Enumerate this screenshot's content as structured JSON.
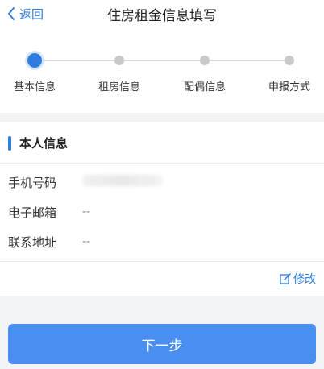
{
  "header": {
    "back_label": "返回",
    "title": "住房租金信息填写"
  },
  "stepper": {
    "steps": [
      {
        "label": "基本信息",
        "active": true
      },
      {
        "label": "租房信息",
        "active": false
      },
      {
        "label": "配偶信息",
        "active": false
      },
      {
        "label": "申报方式",
        "active": false
      }
    ]
  },
  "personal_info": {
    "title": "本人信息",
    "phone_label": "手机号码",
    "phone_value": "",
    "email_label": "电子邮箱",
    "email_value": "--",
    "address_label": "联系地址",
    "address_value": "--",
    "edit_label": "修改"
  },
  "footer": {
    "next_label": "下一步"
  },
  "colors": {
    "accent": "#2f7de1",
    "button": "#4a8ef0",
    "inactive_dot": "#c9c9cc",
    "background": "#f2f3f5"
  }
}
